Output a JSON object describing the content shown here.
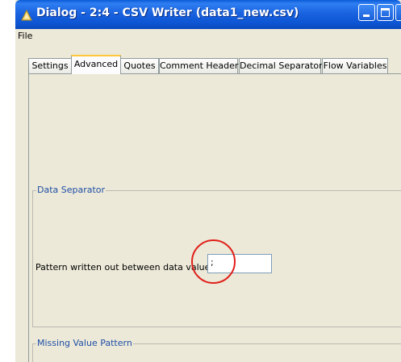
{
  "window": {
    "title": "Dialog - 2:4 - CSV Writer (data1_new.csv)"
  },
  "menu": {
    "file_label": "File"
  },
  "tabs": [
    {
      "label": "Settings"
    },
    {
      "label": "Advanced"
    },
    {
      "label": "Quotes"
    },
    {
      "label": "Comment Header"
    },
    {
      "label": "Decimal Separator"
    },
    {
      "label": "Flow Variables"
    }
  ],
  "active_tab": "Advanced",
  "data_separator": {
    "title": "Data Separator",
    "label": "Pattern written out between data values:",
    "value": ";"
  },
  "missing_value": {
    "title": "Missing Value Pattern"
  },
  "colors": {
    "title_bar": "#1a63e0",
    "group_title": "#1f4ea6",
    "highlight_circle": "#e0201b",
    "active_tab_accent": "#ffc83c"
  }
}
